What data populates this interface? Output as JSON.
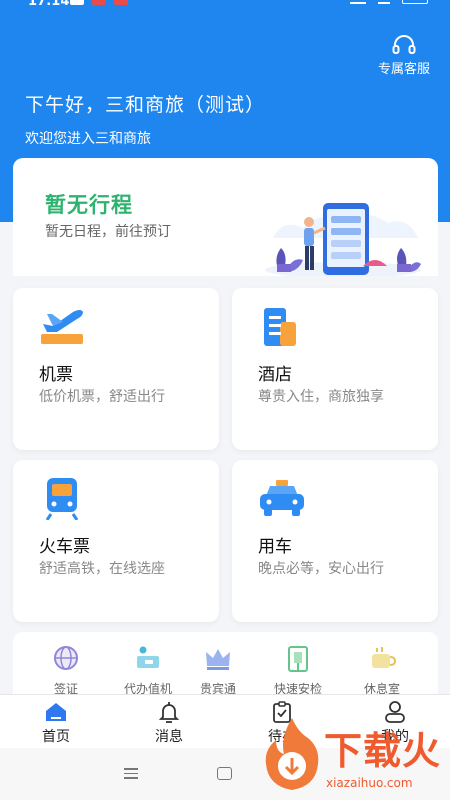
{
  "status_bar": {
    "time": "17:14"
  },
  "header": {
    "customer_service_label": "专属客服",
    "greeting": "下午好，三和商旅（测试）",
    "welcome": "欢迎您进入三和商旅"
  },
  "trip_card": {
    "title": "暂无行程",
    "subtitle": "暂无日程，前往预订"
  },
  "services": [
    {
      "name": "机票",
      "desc": "低价机票，舒适出行",
      "icon": "airplane-icon"
    },
    {
      "name": "酒店",
      "desc": "尊贵入住，商旅独享",
      "icon": "hotel-icon"
    },
    {
      "name": "火车票",
      "desc": "舒适高铁，在线选座",
      "icon": "train-icon"
    },
    {
      "name": "用车",
      "desc": "晚点必等，安心出行",
      "icon": "car-icon"
    }
  ],
  "quick_links": [
    {
      "label": "签证",
      "icon": "globe-icon"
    },
    {
      "label": "代办值机",
      "icon": "checkin-icon"
    },
    {
      "label": "贵宾通",
      "icon": "crown-icon"
    },
    {
      "label": "快速安检",
      "icon": "security-gate-icon"
    },
    {
      "label": "休息室",
      "icon": "lounge-icon"
    }
  ],
  "tabbar": {
    "items": [
      {
        "label": "首页",
        "icon": "home-icon",
        "active": true
      },
      {
        "label": "消息",
        "icon": "bell-icon",
        "active": false
      },
      {
        "label": "待办",
        "icon": "clipboard-check-icon",
        "active": false
      },
      {
        "label": "我的",
        "icon": "user-icon",
        "active": false
      }
    ]
  },
  "watermark": {
    "text": "下载火",
    "url": "xiazaihuo.com"
  },
  "colors": {
    "header_blue": "#1f86f0",
    "trip_green": "#2db36f",
    "icon_blue": "#2f8cf2",
    "icon_orange": "#f7a23b",
    "watermark_orange": "#ef5b2e"
  }
}
